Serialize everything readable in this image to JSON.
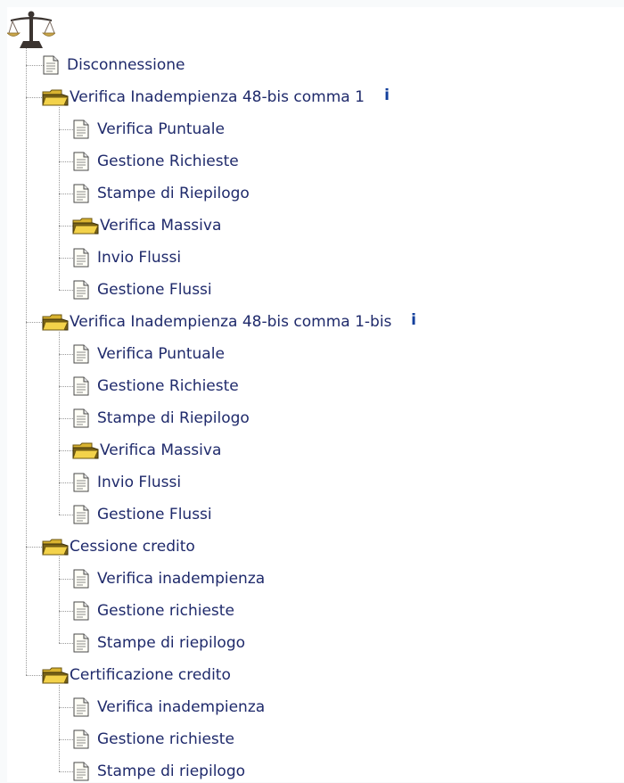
{
  "logo": {
    "icon": "scales-of-justice-icon"
  },
  "menu": {
    "logout": {
      "label": "Disconnessione"
    },
    "groups": [
      {
        "label": "Verifica Inadempienza 48-bis comma 1",
        "info": "i",
        "items": [
          "Verifica Puntuale",
          "Gestione Richieste",
          "Stampe di Riepilogo"
        ],
        "subfolder": "Verifica Massiva",
        "subitems": [
          "Invio Flussi",
          "Gestione Flussi"
        ]
      },
      {
        "label": "Verifica Inadempienza 48-bis comma 1-bis",
        "info": "i",
        "items": [
          "Verifica Puntuale",
          "Gestione Richieste",
          "Stampe di Riepilogo"
        ],
        "subfolder": "Verifica Massiva",
        "subitems": [
          "Invio Flussi",
          "Gestione Flussi"
        ]
      },
      {
        "label": "Cessione credito",
        "items": [
          "Verifica inadempienza",
          "Gestione richieste",
          "Stampe di riepilogo"
        ]
      },
      {
        "label": "Certificazione credito",
        "items": [
          "Verifica inadempienza",
          "Gestione richieste",
          "Stampe di riepilogo"
        ]
      }
    ]
  },
  "colors": {
    "link_text": "#1f2a6b",
    "info_text": "#123f9c",
    "folder_yellow": "#f3d24a",
    "background": "#ffffff"
  }
}
